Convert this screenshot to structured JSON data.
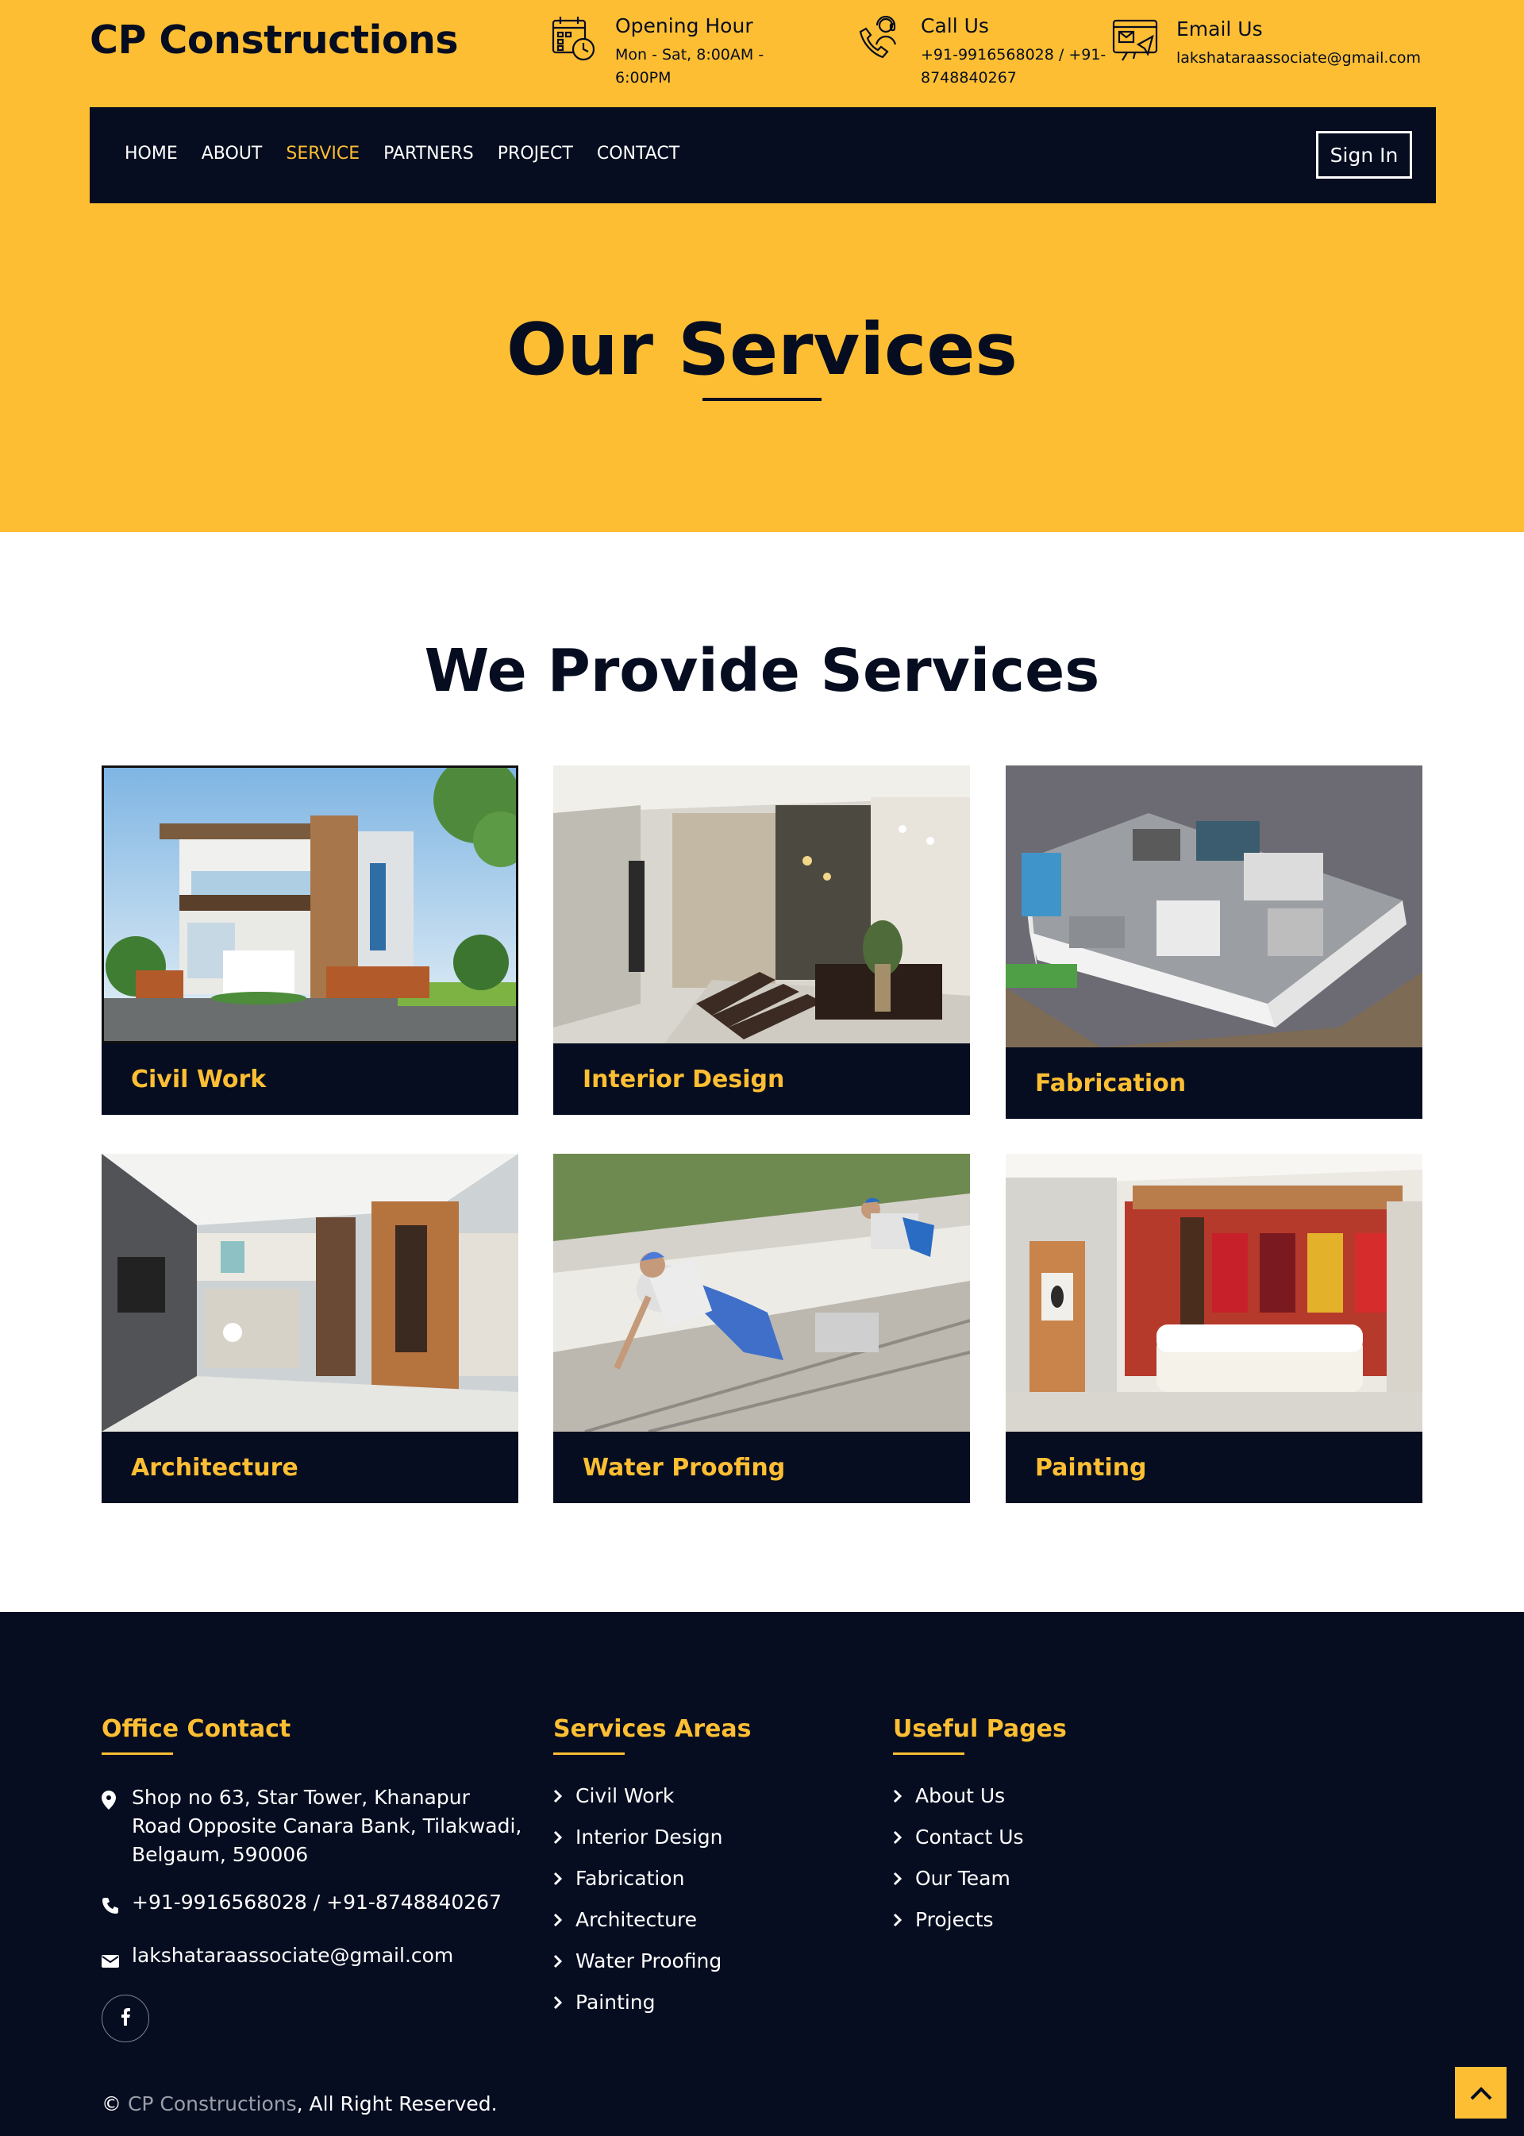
{
  "header": {
    "brand": "CP Constructions",
    "opening": {
      "title": "Opening Hour",
      "line1": "Mon - Sat, 8:00AM -",
      "line2": "6:00PM",
      "icon": "calendar-clock-icon"
    },
    "call": {
      "title": "Call Us",
      "line1": "+91-9916568028 / +91-",
      "line2": "8748840267",
      "icon": "phone-support-icon"
    },
    "email": {
      "title": "Email Us",
      "value": "lakshataraassociate@gmail.com",
      "icon": "email-icon"
    }
  },
  "nav": {
    "items": [
      "HOME",
      "ABOUT",
      "SERVICE",
      "PARTNERS",
      "PROJECT",
      "CONTACT"
    ],
    "active": "SERVICE",
    "signin": "Sign In"
  },
  "hero": {
    "title": "Our Services"
  },
  "services": {
    "title": "We Provide Services",
    "items": [
      {
        "label": "Civil Work"
      },
      {
        "label": "Interior Design"
      },
      {
        "label": "Fabrication"
      },
      {
        "label": "Architecture"
      },
      {
        "label": "Water Proofing"
      },
      {
        "label": "Painting"
      }
    ]
  },
  "footer": {
    "office": {
      "title": "Office Contact",
      "address": "Shop no 63, Star Tower, Khanapur Road Opposite Canara Bank, Tilakwadi, Belgaum, 590006",
      "phone": "+91-9916568028 / +91-8748840267",
      "email": "lakshataraassociate@gmail.com"
    },
    "areas": {
      "title": "Services Areas",
      "items": [
        "Civil Work",
        "Interior Design",
        "Fabrication",
        "Architecture",
        "Water Proofing",
        "Painting"
      ]
    },
    "pages": {
      "title": "Useful Pages",
      "items": [
        "About Us",
        "Contact Us",
        "Our Team",
        "Projects"
      ]
    },
    "copyright": {
      "prefix": "©",
      "brand": "CP Constructions",
      "suffix": ", All Right Reserved."
    }
  },
  "colors": {
    "accent": "#fdbe33",
    "dark": "#060d20"
  }
}
